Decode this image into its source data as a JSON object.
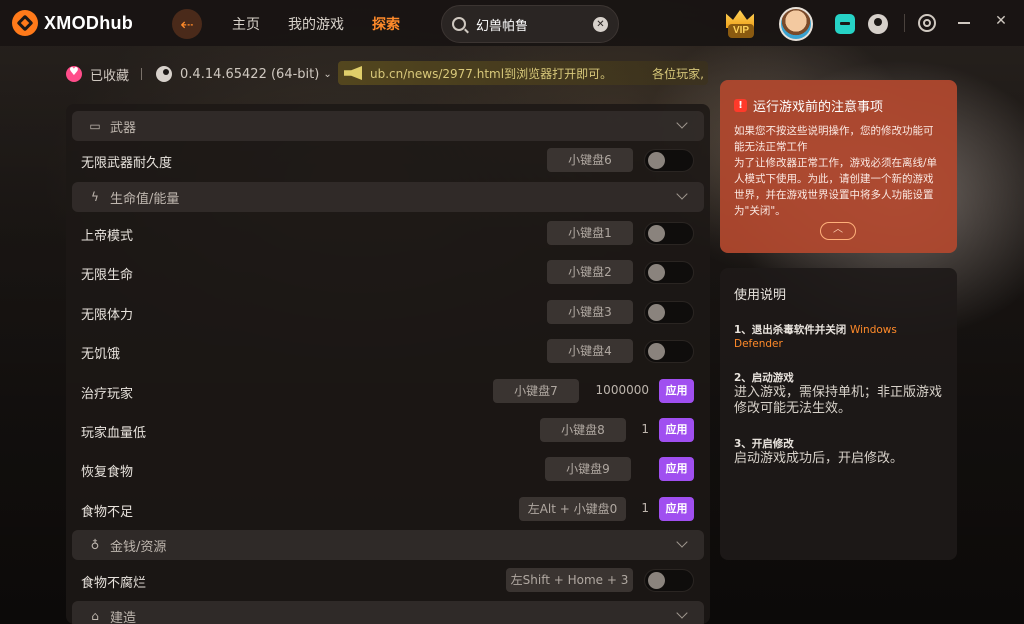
{
  "header": {
    "logo_text": "XMODhub",
    "nav": [
      "主页",
      "我的游戏",
      "探索"
    ],
    "search_value": "幻兽帕鲁",
    "vip_label": "VIP"
  },
  "subbar": {
    "favorite_label": "已收藏",
    "version": "0.4.14.65422 (64-bit)",
    "notice_text": "ub.cn/news/2977.html到浏览器打开即可。",
    "notice_text_2": "各位玩家,"
  },
  "categories": {
    "weapons": "武器",
    "health": "生命值/能量",
    "money": "金钱/资源",
    "build": "建造"
  },
  "rows": [
    {
      "label": "无限武器耐久度",
      "key": "小键盘6"
    },
    {
      "label": "上帝模式",
      "key": "小键盘1"
    },
    {
      "label": "无限生命",
      "key": "小键盘2"
    },
    {
      "label": "无限体力",
      "key": "小键盘3"
    },
    {
      "label": "无饥饿",
      "key": "小键盘4"
    },
    {
      "label": "治疗玩家",
      "key": "小键盘7",
      "value": "1000000",
      "apply": "应用"
    },
    {
      "label": "玩家血量低",
      "key": "小键盘8",
      "value": "1",
      "apply": "应用"
    },
    {
      "label": "恢复食物",
      "key": "小键盘9",
      "apply": "应用"
    },
    {
      "label": "食物不足",
      "key": "左Alt + 小键盘0",
      "value": "1",
      "apply": "应用"
    },
    {
      "label": "食物不腐烂",
      "key": "左Shift + Home + 3"
    }
  ],
  "warning": {
    "title": "运行游戏前的注意事项",
    "line1": "如果您不按这些说明操作，您的修改功能可能无法正常工作",
    "line2": "为了让修改器正常工作，游戏必须在离线/单人模式下使用。为此，请创建一个新的游戏世界，并在游戏世界设置中将多人功能设置为\"关闭\"。"
  },
  "guide": {
    "title": "使用说明",
    "step1_title": "1、退出杀毒软件并关闭",
    "step1_highlight": "Windows Defender",
    "step2_title": "2、启动游戏",
    "step2_desc": "进入游戏，需保持单机；非正版游戏修改可能无法生效。",
    "step3_title": "3、开启修改",
    "step3_desc": "启动游戏成功后，开启修改。"
  },
  "colors": {
    "accent": "#ff8a2a",
    "apply": "#a04ff0",
    "warning_bg": "#b2482e"
  }
}
